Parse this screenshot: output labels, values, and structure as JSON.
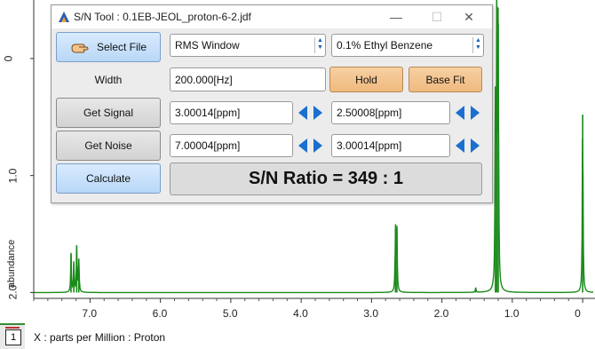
{
  "window": {
    "title": "S/N Tool : 0.1EB-JEOL_proton-6-2.jdf",
    "minimize_glyph": "—",
    "maximize_glyph": "☐",
    "close_glyph": "✕"
  },
  "buttons": {
    "select_file": "Select File",
    "hold": "Hold",
    "base_fit": "Base Fit",
    "get_signal": "Get Signal",
    "get_noise": "Get Noise",
    "calculate": "Calculate"
  },
  "labels": {
    "width": "Width"
  },
  "selects": {
    "method": "RMS Window",
    "sample": "0.1% Ethyl Benzene"
  },
  "fields": {
    "width": "200.000[Hz]",
    "signal_start": "3.00014[ppm]",
    "signal_end": "2.50008[ppm]",
    "noise_start": "7.00004[ppm]",
    "noise_end": "3.00014[ppm]"
  },
  "result": "S/N Ratio = 349 : 1",
  "plot": {
    "ylabel": "abundance",
    "xcaption": "X : parts per Million : Proton",
    "layer_number": "1",
    "y_ticks": [
      "2.0",
      "1.0",
      "0"
    ],
    "x_ticks": [
      "7.0",
      "6.0",
      "5.0",
      "4.0",
      "3.0",
      "2.0",
      "1.0",
      "0"
    ],
    "trace_color": "#1a8a1a"
  },
  "chart_data": {
    "type": "line",
    "xlabel": "X : parts per Million : Proton",
    "ylabel": "abundance",
    "xlim": [
      7.8,
      -0.15
    ],
    "ylim": [
      -0.05,
      2.5
    ],
    "x_ticks": [
      7,
      6,
      5,
      4,
      3,
      2,
      1,
      0
    ],
    "y_ticks": [
      0,
      1,
      2
    ],
    "peaks": [
      {
        "x": 7.27,
        "y": 0.33
      },
      {
        "x": 7.23,
        "y": 0.25
      },
      {
        "x": 7.19,
        "y": 0.39
      },
      {
        "x": 7.16,
        "y": 0.29
      },
      {
        "x": 2.66,
        "y": 0.55
      },
      {
        "x": 2.64,
        "y": 0.54
      },
      {
        "x": 1.52,
        "y": 0.04
      },
      {
        "x": 1.24,
        "y": 1.6
      },
      {
        "x": 1.22,
        "y": 2.45
      },
      {
        "x": 1.2,
        "y": 2.3
      },
      {
        "x": 0.0,
        "y": 1.52
      }
    ]
  }
}
